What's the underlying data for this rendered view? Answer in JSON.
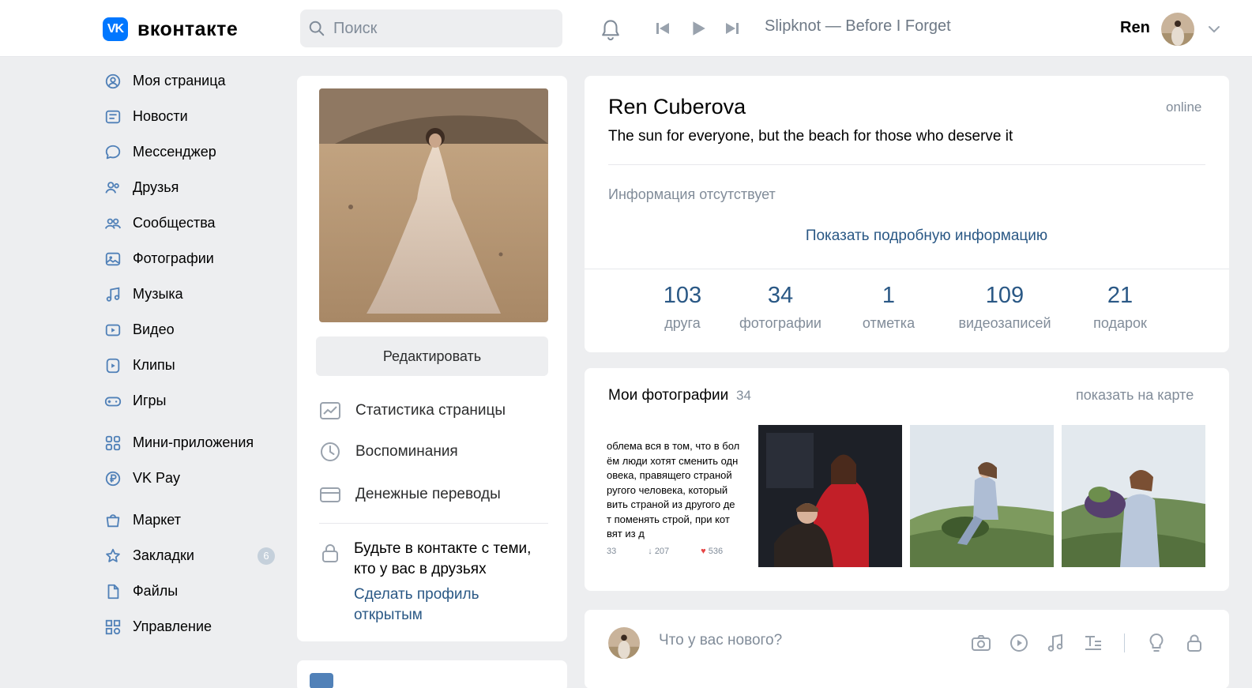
{
  "header": {
    "logo_mark": "VK",
    "logo_text": "вконтакте",
    "search_placeholder": "Поиск",
    "player_track": "Slipknot — Before I Forget",
    "user_name": "Ren"
  },
  "nav": {
    "items": [
      {
        "label": "Моя страница",
        "icon": "home-icon"
      },
      {
        "label": "Новости",
        "icon": "news-icon"
      },
      {
        "label": "Мессенджер",
        "icon": "chat-icon"
      },
      {
        "label": "Друзья",
        "icon": "friends-icon"
      },
      {
        "label": "Сообщества",
        "icon": "groups-icon"
      },
      {
        "label": "Фотографии",
        "icon": "photo-icon"
      },
      {
        "label": "Музыка",
        "icon": "music-icon"
      },
      {
        "label": "Видео",
        "icon": "video-icon"
      },
      {
        "label": "Клипы",
        "icon": "clips-icon"
      },
      {
        "label": "Игры",
        "icon": "games-icon"
      },
      {
        "label": "Мини-приложения",
        "icon": "apps-icon"
      },
      {
        "label": "VK Pay",
        "icon": "vkpay-icon"
      },
      {
        "label": "Маркет",
        "icon": "market-icon"
      },
      {
        "label": "Закладки",
        "icon": "bookmark-icon"
      },
      {
        "label": "Файлы",
        "icon": "file-icon"
      },
      {
        "label": "Управление",
        "icon": "manage-icon"
      }
    ],
    "bookmarks_count": "6"
  },
  "left_col": {
    "edit_label": "Редактировать",
    "menu": [
      {
        "label": "Статистика страницы",
        "icon": "stats-icon"
      },
      {
        "label": "Воспоминания",
        "icon": "memories-icon"
      },
      {
        "label": "Денежные переводы",
        "icon": "transfer-icon"
      }
    ],
    "friends_note": "Будьте в контакте с теми, кто у вас в друзьях",
    "open_profile": "Сделать профиль открытым"
  },
  "profile": {
    "name": "Ren Cuberova",
    "online": "online",
    "status": "The sun for everyone, but the beach for those who deserve it",
    "no_info": "Информация отсутствует",
    "show_more": "Показать подробную информацию",
    "stats": [
      {
        "num": "103",
        "label": "друга"
      },
      {
        "num": "34",
        "label": "фотографии"
      },
      {
        "num": "1",
        "label": "отметка"
      },
      {
        "num": "109",
        "label": "видеозаписей"
      },
      {
        "num": "21",
        "label": "подарок"
      }
    ]
  },
  "photos": {
    "title": "Мои фотографии",
    "count": "34",
    "show_map": "показать на карте",
    "text_thumb": {
      "lines": [
        "облема вся в том, что в бол",
        "ём люди хотят сменить одн",
        "овека, правящего страной",
        "ругого человека, который",
        "вить страной из другого де",
        "т поменять строй, при кот",
        "вят из д"
      ],
      "comments": "33",
      "reposts": "207",
      "likes": "536"
    }
  },
  "post": {
    "placeholder": "Что у вас нового?"
  }
}
